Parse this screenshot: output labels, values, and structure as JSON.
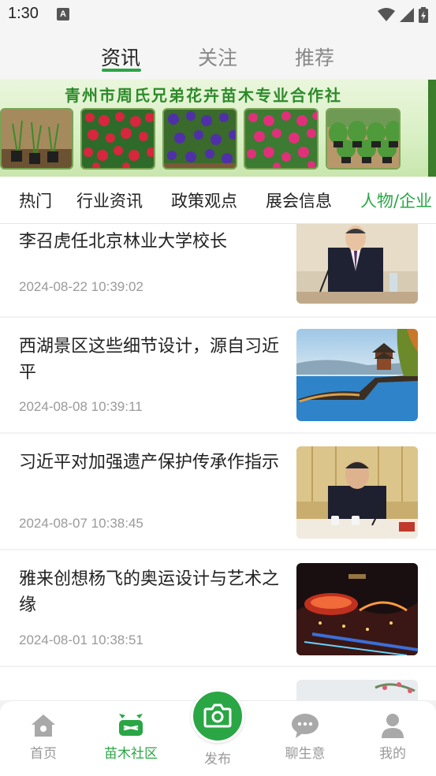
{
  "status_bar": {
    "time": "1:30",
    "notification_badge": "A"
  },
  "top_tabs": [
    {
      "label": "资讯",
      "active": true
    },
    {
      "label": "关注",
      "active": false
    },
    {
      "label": "推荐",
      "active": false
    }
  ],
  "banner": {
    "title": "青州市周氏兄弟花卉苗木专业合作社"
  },
  "category_tabs": [
    {
      "label": "热门",
      "active": false
    },
    {
      "label": "行业资讯",
      "active": false
    },
    {
      "label": "政策观点",
      "active": false
    },
    {
      "label": "展会信息",
      "active": false
    },
    {
      "label": "人物/企业",
      "active": true
    }
  ],
  "news": [
    {
      "title": "李召虎任北京林业大学校长",
      "date": "2024-08-22 10:39:02"
    },
    {
      "title": "西湖景区这些细节设计，源自习近平",
      "date": "2024-08-08 10:39:11"
    },
    {
      "title": "习近平对加强遗产保护传承作指示",
      "date": "2024-08-07 10:38:45"
    },
    {
      "title": "雅来创想杨飞的奥运设计与艺术之缘",
      "date": "2024-08-01 10:38:51"
    }
  ],
  "bottom_nav": {
    "home": "首页",
    "community": "苗木社区",
    "publish": "发布",
    "chat": "聊生意",
    "mine": "我的"
  },
  "colors": {
    "accent": "#2aa645",
    "inactive": "#999999"
  }
}
